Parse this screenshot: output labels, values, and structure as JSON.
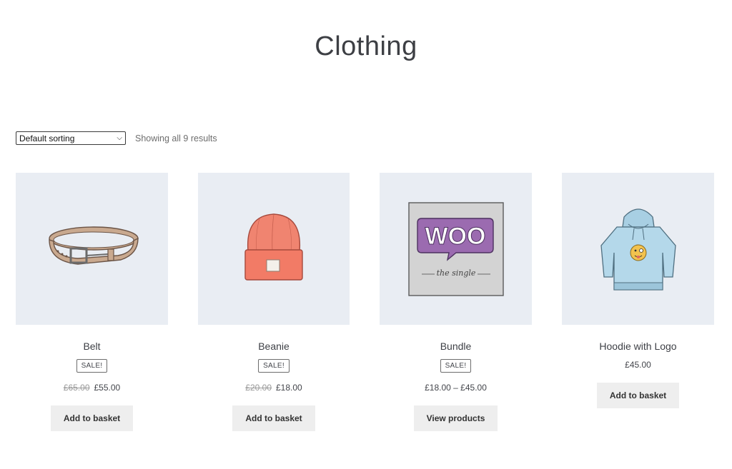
{
  "page": {
    "title": "Clothing"
  },
  "toolbar": {
    "sort_selected": "Default sorting",
    "result_count": "Showing all 9 results"
  },
  "products": [
    {
      "name": "Belt",
      "sale_badge": "SALE!",
      "old_price": "£65.00",
      "price": "£55.00",
      "button": "Add to basket"
    },
    {
      "name": "Beanie",
      "sale_badge": "SALE!",
      "old_price": "£20.00",
      "price": "£18.00",
      "button": "Add to basket"
    },
    {
      "name": "Bundle",
      "sale_badge": "SALE!",
      "price": "£18.00 – £45.00",
      "button": "View products",
      "image_text": "WOO",
      "image_caption": "the single"
    },
    {
      "name": "Hoodie with Logo",
      "price": "£45.00",
      "button": "Add to basket"
    }
  ],
  "colors": {
    "thumb_bg": "#e9edf3",
    "button_bg": "#eeeeee",
    "text": "#43454b"
  }
}
